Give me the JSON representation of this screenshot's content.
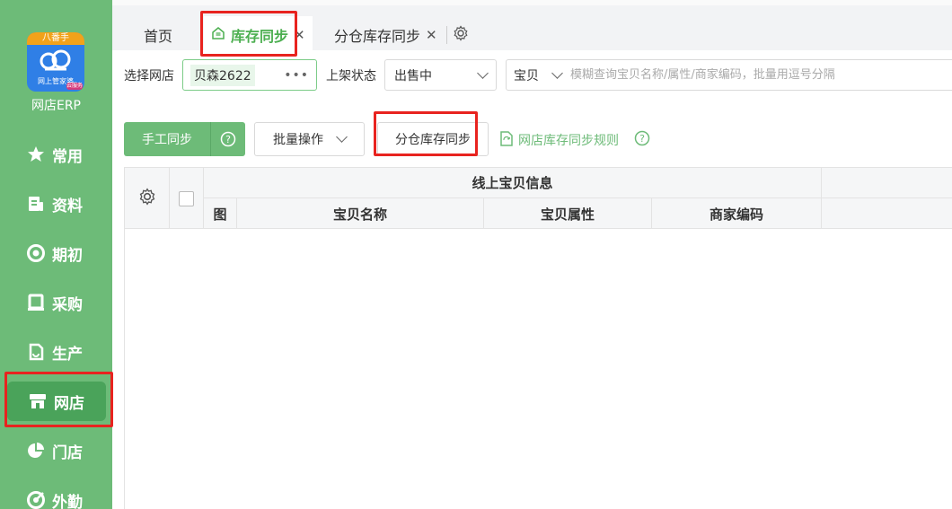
{
  "sidebar": {
    "logo": {
      "top_text": "八番手",
      "sub_text": "网上管家婆",
      "badge": "云服务"
    },
    "app_name": "网店ERP",
    "items": [
      {
        "label": "常用",
        "icon": "star-icon"
      },
      {
        "label": "资料",
        "icon": "document-icon"
      },
      {
        "label": "期初",
        "icon": "target-icon"
      },
      {
        "label": "采购",
        "icon": "book-icon"
      },
      {
        "label": "生产",
        "icon": "production-icon"
      },
      {
        "label": "网店",
        "icon": "store-icon",
        "active": true
      },
      {
        "label": "门店",
        "icon": "pie-chart-icon"
      },
      {
        "label": "外勤",
        "icon": "compass-icon"
      }
    ]
  },
  "tabs": [
    {
      "label": "首页"
    },
    {
      "label": "库存同步",
      "icon": "home-sync-icon",
      "active": true,
      "close": "✕"
    },
    {
      "label": "分仓库存同步",
      "close": "✕"
    }
  ],
  "filters": {
    "shop_label": "选择网店",
    "shop_value": "贝森2622",
    "status_label": "上架状态",
    "status_value": "出售中",
    "search_type": "宝贝",
    "search_placeholder": "模糊查询宝贝名称/属性/商家编码，批量用逗号分隔"
  },
  "actions": {
    "manual_sync": "手工同步",
    "batch_ops": "批量操作",
    "warehouse_sync": "分仓库存同步",
    "rule_link": "网店库存同步规则"
  },
  "table": {
    "group_header": "线上宝贝信息",
    "columns": [
      "图",
      "宝贝名称",
      "宝贝属性",
      "商家编码"
    ]
  },
  "colors": {
    "brand_green": "#6dbb78",
    "highlight_red": "#e8231f"
  }
}
